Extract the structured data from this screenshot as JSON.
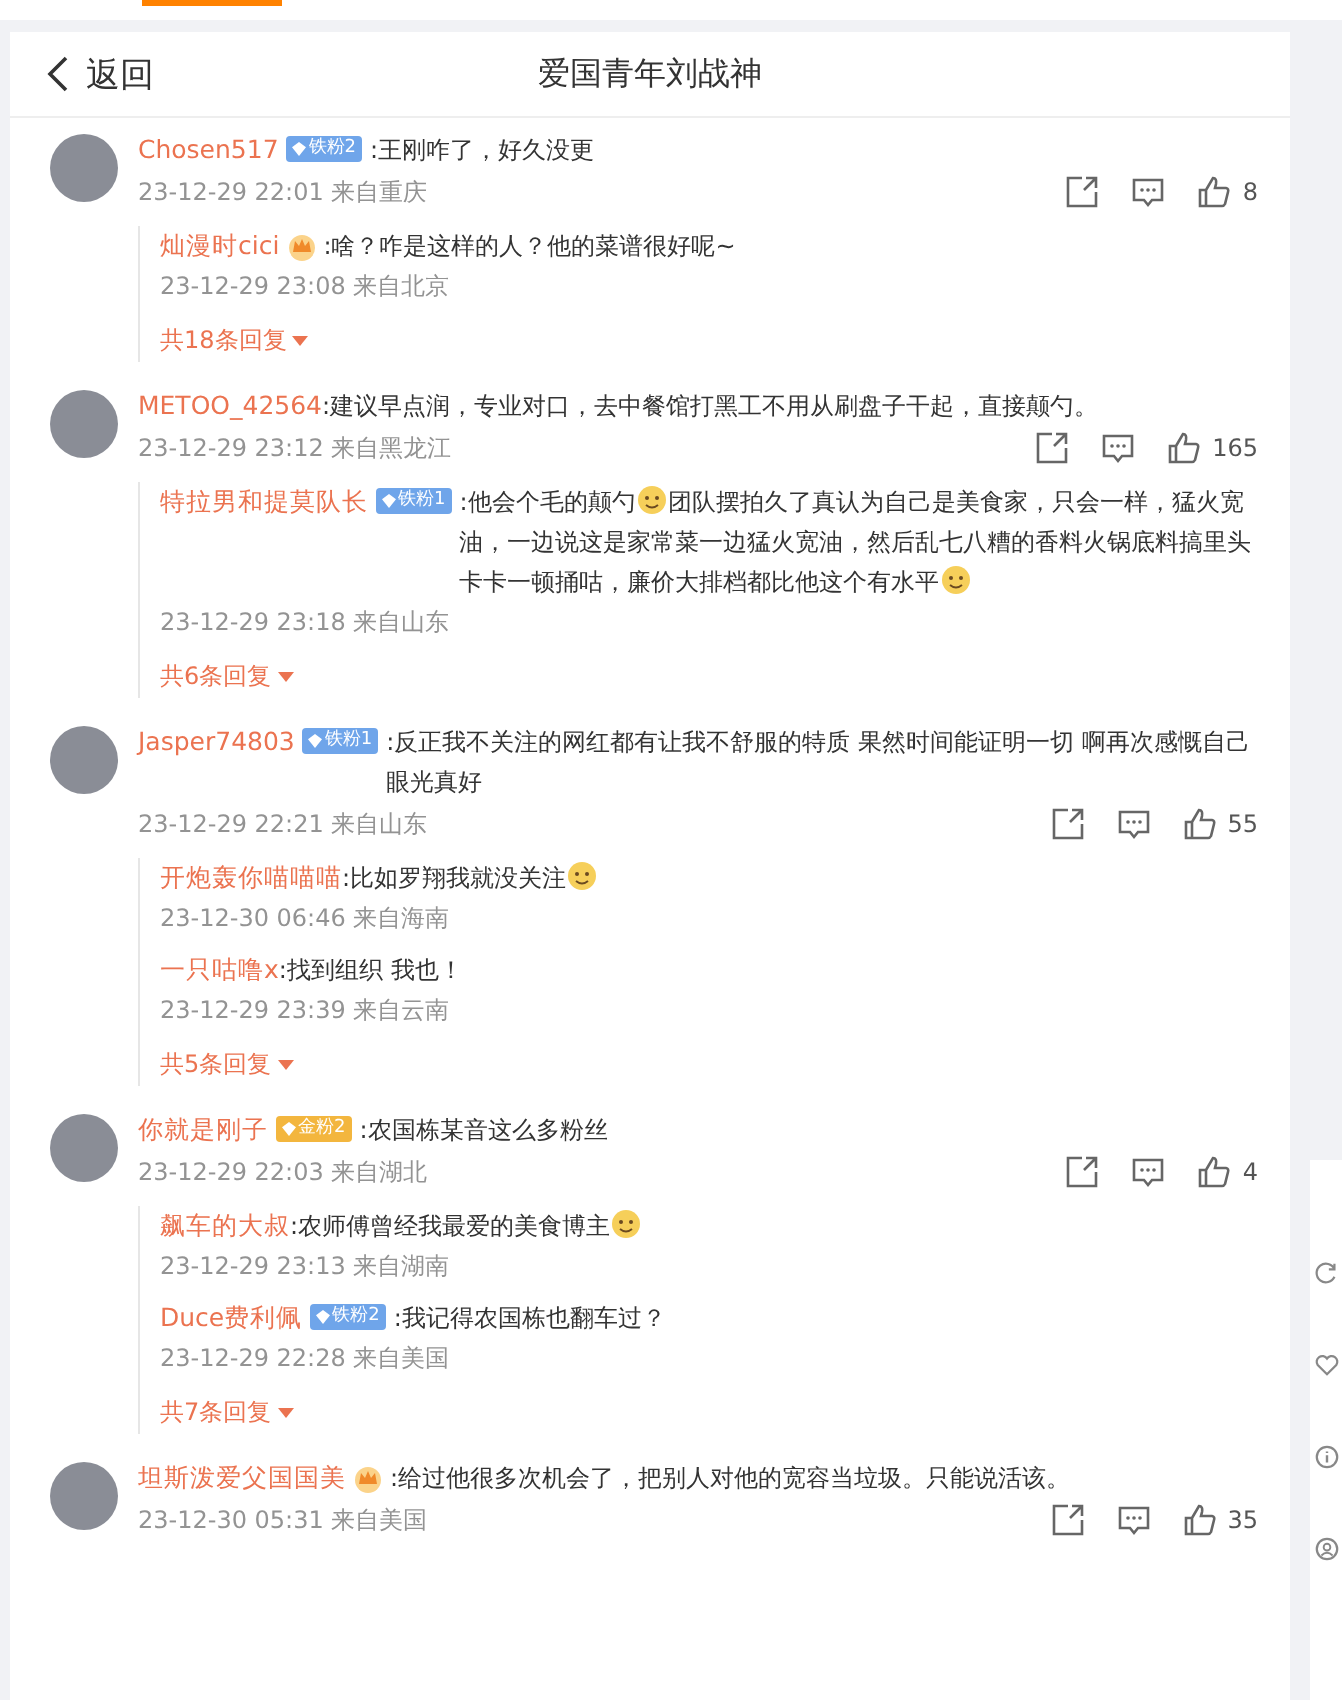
{
  "header": {
    "back": "返回",
    "title": "爱国青年刘战神"
  },
  "comments": [
    {
      "name": "Chosen517",
      "badge": {
        "kind": "iron",
        "text": "铁粉2"
      },
      "content": [
        {
          "kind": "text",
          "text": ":王刚咋了，好久没更"
        }
      ],
      "time": "23-12-29 22:01 来自重庆",
      "likes": "8",
      "replies": [
        {
          "name": "灿漫时cici",
          "badge": {
            "kind": "crown"
          },
          "content": [
            {
              "kind": "text",
              "text": ":啥？咋是这样的人？他的菜谱很好呢~"
            }
          ],
          "time": "23-12-29 23:08 来自北京"
        }
      ],
      "more": "共18条回复"
    },
    {
      "name": "METOO_42564",
      "content": [
        {
          "kind": "text",
          "text": ":建议早点润，专业对口，去中餐馆打黑工不用从刷盘子干起，直接颠勺。"
        }
      ],
      "time": "23-12-29 23:12 来自黑龙江",
      "likes": "165",
      "replies": [
        {
          "name": "特拉男和提莫队长",
          "badge": {
            "kind": "iron",
            "text": "铁粉1"
          },
          "content": [
            {
              "kind": "text",
              "text": ":他会个毛的颠勺"
            },
            {
              "kind": "emoji"
            },
            {
              "kind": "text",
              "text": "团队摆拍久了真认为自己是美食家，只会一样，猛火宽油，一边说这是家常菜一边猛火宽油，然后乱七八糟的香料火锅底料搞里头卡卡一顿捅咕，廉价大排档都比他这个有水平"
            },
            {
              "kind": "emoji"
            }
          ],
          "time": "23-12-29 23:18 来自山东"
        }
      ],
      "more": "共6条回复"
    },
    {
      "name": "Jasper74803",
      "badge": {
        "kind": "iron",
        "text": "铁粉1"
      },
      "content": [
        {
          "kind": "text",
          "text": ":反正我不关注的网红都有让我不舒服的特质 果然时间能证明一切 啊再次感慨自己眼光真好"
        }
      ],
      "time": "23-12-29 22:21 来自山东",
      "likes": "55",
      "replies": [
        {
          "name": "开炮轰你喵喵喵",
          "content": [
            {
              "kind": "text",
              "text": ":比如罗翔我就没关注"
            },
            {
              "kind": "emoji"
            }
          ],
          "time": "23-12-30 06:46 来自海南"
        },
        {
          "name": "一只咕噜x",
          "content": [
            {
              "kind": "text",
              "text": ":找到组织 我也！"
            }
          ],
          "time": "23-12-29 23:39 来自云南"
        }
      ],
      "more": "共5条回复"
    },
    {
      "name": "你就是刚子",
      "badge": {
        "kind": "gold",
        "text": "金粉2"
      },
      "content": [
        {
          "kind": "text",
          "text": ":农国栋某音这么多粉丝"
        }
      ],
      "time": "23-12-29 22:03 来自湖北",
      "likes": "4",
      "replies": [
        {
          "name": "飙车的大叔",
          "content": [
            {
              "kind": "text",
              "text": ":农师傅曾经我最爱的美食博主"
            },
            {
              "kind": "emoji"
            }
          ],
          "time": "23-12-29 23:13 来自湖南"
        },
        {
          "name": "Duce费利佩",
          "badge": {
            "kind": "iron",
            "text": "铁粉2"
          },
          "content": [
            {
              "kind": "text",
              "text": ":我记得农国栋也翻车过？"
            }
          ],
          "time": "23-12-29 22:28 来自美国"
        }
      ],
      "more": "共7条回复"
    },
    {
      "name": "坦斯泼爱父国国美",
      "badge": {
        "kind": "crown"
      },
      "content": [
        {
          "kind": "text",
          "text": ":给过他很多次机会了，把别人对他的宽容当垃圾。只能说活该。"
        }
      ],
      "time": "23-12-30 05:31 来自美国",
      "likes": "35"
    }
  ]
}
